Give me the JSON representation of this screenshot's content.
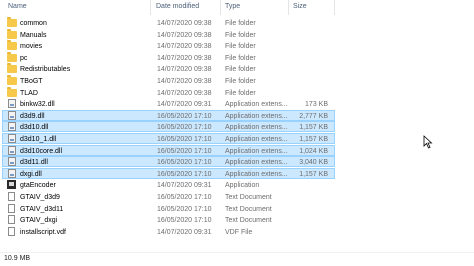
{
  "columns": {
    "name": "Name",
    "date": "Date modified",
    "type": "Type",
    "size": "Size"
  },
  "files": [
    {
      "name": "common",
      "date": "14/07/2020 09:38",
      "type": "File folder",
      "size": "",
      "icon": "folder-icon",
      "selected": false
    },
    {
      "name": "Manuals",
      "date": "14/07/2020 09:38",
      "type": "File folder",
      "size": "",
      "icon": "folder-icon",
      "selected": false
    },
    {
      "name": "movies",
      "date": "14/07/2020 09:38",
      "type": "File folder",
      "size": "",
      "icon": "folder-icon",
      "selected": false
    },
    {
      "name": "pc",
      "date": "14/07/2020 09:38",
      "type": "File folder",
      "size": "",
      "icon": "folder-icon",
      "selected": false
    },
    {
      "name": "Redistributables",
      "date": "14/07/2020 09:38",
      "type": "File folder",
      "size": "",
      "icon": "folder-icon",
      "selected": false
    },
    {
      "name": "TBoGT",
      "date": "14/07/2020 09:38",
      "type": "File folder",
      "size": "",
      "icon": "folder-icon",
      "selected": false
    },
    {
      "name": "TLAD",
      "date": "14/07/2020 09:38",
      "type": "File folder",
      "size": "",
      "icon": "folder-icon",
      "selected": false
    },
    {
      "name": "binkw32.dll",
      "date": "14/07/2020 09:31",
      "type": "Application extens...",
      "size": "173 KB",
      "icon": "dll-file-icon",
      "selected": false
    },
    {
      "name": "d3d9.dll",
      "date": "16/05/2020 17:10",
      "type": "Application extens...",
      "size": "2,777 KB",
      "icon": "dll-file-icon",
      "selected": true
    },
    {
      "name": "d3d10.dll",
      "date": "16/05/2020 17:10",
      "type": "Application extens...",
      "size": "1,157 KB",
      "icon": "dll-file-icon",
      "selected": true
    },
    {
      "name": "d3d10_1.dll",
      "date": "16/05/2020 17:10",
      "type": "Application extens...",
      "size": "1,157 KB",
      "icon": "dll-file-icon",
      "selected": true
    },
    {
      "name": "d3d10core.dll",
      "date": "16/05/2020 17:10",
      "type": "Application extens...",
      "size": "1,024 KB",
      "icon": "dll-file-icon",
      "selected": true
    },
    {
      "name": "d3d11.dll",
      "date": "16/05/2020 17:10",
      "type": "Application extens...",
      "size": "3,040 KB",
      "icon": "dll-file-icon",
      "selected": true
    },
    {
      "name": "dxgi.dll",
      "date": "16/05/2020 17:10",
      "type": "Application extens...",
      "size": "1,157 KB",
      "icon": "dll-file-icon",
      "selected": true
    },
    {
      "name": "gtaEncoder",
      "date": "14/07/2020 09:31",
      "type": "Application",
      "size": "",
      "icon": "application-icon",
      "selected": false
    },
    {
      "name": "GTAIV_d3d9",
      "date": "16/05/2020 17:10",
      "type": "Text Document",
      "size": "",
      "icon": "text-document-icon",
      "selected": false
    },
    {
      "name": "GTAIV_d3d11",
      "date": "16/05/2020 17:10",
      "type": "Text Document",
      "size": "",
      "icon": "text-document-icon",
      "selected": false
    },
    {
      "name": "GTAIV_dxgi",
      "date": "16/05/2020 17:10",
      "type": "Text Document",
      "size": "",
      "icon": "text-document-icon",
      "selected": false
    },
    {
      "name": "installscript.vdf",
      "date": "14/07/2020 09:31",
      "type": "VDF File",
      "size": "",
      "icon": "vdf-file-icon",
      "selected": false
    }
  ],
  "status": {
    "selection_size": "10.9 MB"
  }
}
